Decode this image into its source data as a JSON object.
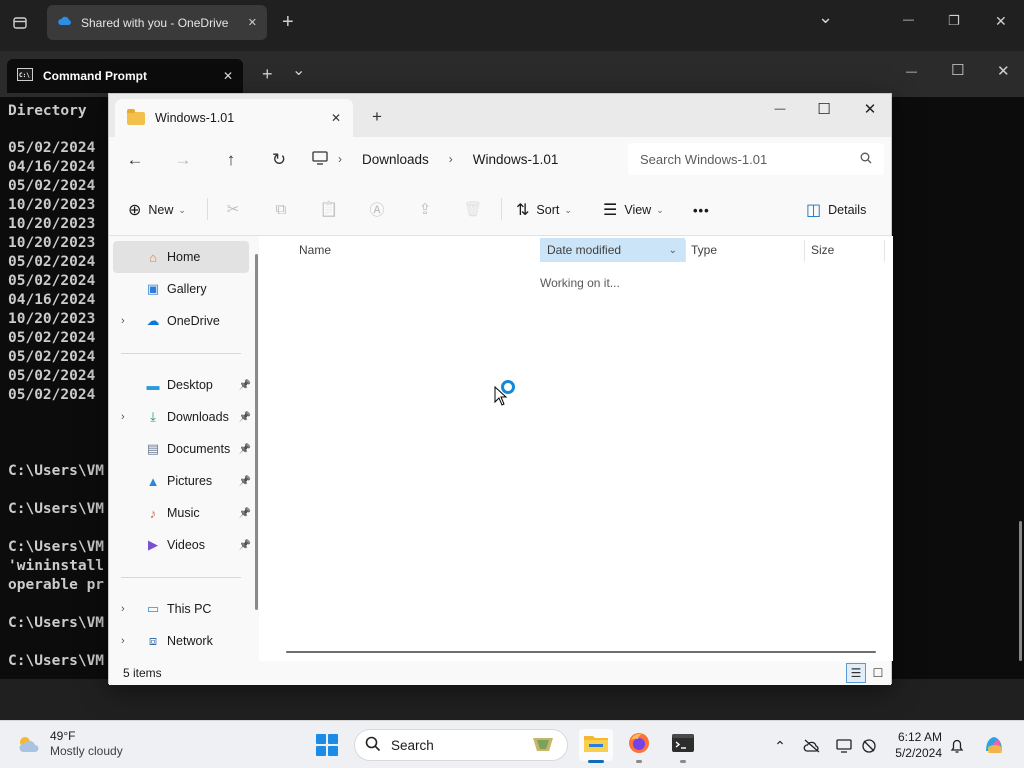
{
  "browser": {
    "tab_title": "Shared with you - OneDrive",
    "close_glyph": "✕",
    "new_tab_glyph": "+",
    "chevron_glyph": "⌄",
    "minimize_glyph": "—",
    "restore_glyph": "❐",
    "window_close_glyph": "✕"
  },
  "terminal": {
    "tab_title": "Command Prompt",
    "tab_close_glyph": "✕",
    "new_tab_glyph": "+",
    "dropdown_glyph": "⌄",
    "minimize_glyph": "—",
    "maximize_glyph": "☐",
    "close_glyph": "✕",
    "lines": [
      {
        "text": "Directory"
      },
      {
        "text": "05/02/2024"
      },
      {
        "text": "04/16/2024"
      },
      {
        "text": "05/02/2024"
      },
      {
        "text": "10/20/2023"
      },
      {
        "text": "10/20/2023"
      },
      {
        "text": "10/20/2023"
      },
      {
        "text": "05/02/2024"
      },
      {
        "text": "05/02/2024"
      },
      {
        "text": "04/16/2024"
      },
      {
        "text": "10/20/2023"
      },
      {
        "text": "05/02/2024"
      },
      {
        "text": "05/02/2024"
      },
      {
        "text": "05/02/2024"
      },
      {
        "text": "05/02/2024"
      },
      {
        "text": "C:\\Users\\VM"
      },
      {
        "text": "C:\\Users\\VM"
      },
      {
        "text": "C:\\Users\\VM"
      },
      {
        "text": "'wininstall"
      },
      {
        "text": "operable pr"
      },
      {
        "text": "C:\\Users\\VM"
      },
      {
        "text": "C:\\Users\\VM"
      }
    ]
  },
  "explorer": {
    "tab_title": "Windows-1.01",
    "tab_close_glyph": "✕",
    "new_tab_glyph": "+",
    "minimize_glyph": "—",
    "maximize_glyph": "☐",
    "close_glyph": "✕",
    "nav": {
      "back_glyph": "←",
      "forward_glyph": "→",
      "up_glyph": "↑",
      "refresh_glyph": "↻"
    },
    "address": {
      "pc_glyph": "🖵",
      "separator_glyph": "›",
      "crumbs": [
        "Downloads",
        "Windows-1.01"
      ]
    },
    "search": {
      "placeholder": "Search Windows-1.01",
      "icon_glyph": "⌕"
    },
    "toolbar": {
      "new_label": "New",
      "new_glyph": "⊕",
      "cut_glyph": "✂",
      "copy_glyph": "⧉",
      "paste_glyph": "📋",
      "rename_glyph": "Ⓐ",
      "share_glyph": "⇪",
      "delete_glyph": "🗑",
      "sort_label": "Sort",
      "sort_glyph": "⇅",
      "view_label": "View",
      "view_glyph": "☰",
      "more_glyph": "•••",
      "details_label": "Details",
      "details_glyph": "◫",
      "caret_glyph": "⌄"
    },
    "nav_pane": {
      "chevron_glyph": "›",
      "pin_glyph": "📌",
      "items": [
        {
          "label": "Home",
          "icon": "home-icon",
          "glyph": "⌂",
          "color": "#e8833a"
        },
        {
          "label": "Gallery",
          "icon": "gallery-icon",
          "glyph": "▣",
          "color": "#2f7fd6"
        },
        {
          "label": "OneDrive",
          "icon": "onedrive-icon",
          "glyph": "☁",
          "color": "#0f78d4"
        },
        {
          "label": "Desktop",
          "icon": "desktop-icon",
          "glyph": "▬",
          "color": "#2b9be0"
        },
        {
          "label": "Downloads",
          "icon": "downloads-icon",
          "glyph": "⤓",
          "color": "#1f9b57"
        },
        {
          "label": "Documents",
          "icon": "documents-icon",
          "glyph": "▤",
          "color": "#6b7b94"
        },
        {
          "label": "Pictures",
          "icon": "pictures-icon",
          "glyph": "▲",
          "color": "#2f86d9"
        },
        {
          "label": "Music",
          "icon": "music-icon",
          "glyph": "♪",
          "color": "#d9684a"
        },
        {
          "label": "Videos",
          "icon": "videos-icon",
          "glyph": "▶",
          "color": "#7a4fd1"
        },
        {
          "label": "This PC",
          "icon": "this-pc-icon",
          "glyph": "▭",
          "color": "#2a8bd9"
        },
        {
          "label": "Network",
          "icon": "network-icon",
          "glyph": "⧈",
          "color": "#3a6ea8"
        }
      ]
    },
    "columns": {
      "name": "Name",
      "date_modified": "Date modified",
      "type": "Type",
      "size": "Size",
      "sort_caret_glyph": "⌄"
    },
    "status_message": "Working on it...",
    "status_bar": {
      "item_count": "5 items",
      "details_view_glyph": "☰",
      "tiles_view_glyph": "☐"
    }
  },
  "taskbar": {
    "weather": {
      "temp": "49°F",
      "condition": "Mostly cloudy"
    },
    "search_label": "Search",
    "search_glyph": "⌕",
    "tray": {
      "chevron_glyph": "⌃",
      "cloud_glyph": "☁",
      "display_glyph": "▭",
      "wifi_glyph": "◎",
      "bell_glyph": "🔔"
    },
    "clock": {
      "time": "6:12 AM",
      "date": "5/2/2024"
    }
  },
  "colors": {
    "accent": "#0f8bd9",
    "sorted_column": "#cce4f7",
    "terminal_bg": "#0c0c0c",
    "terminal_text": "#cccccc"
  }
}
